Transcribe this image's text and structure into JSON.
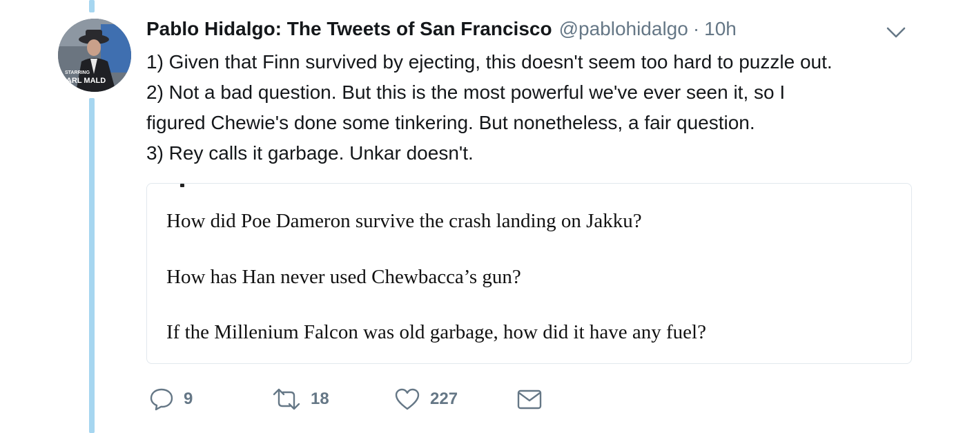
{
  "author": {
    "display_name": "Pablo Hidalgo: The Tweets of San Francisco",
    "handle": "@pablohidalgo",
    "separator": "·",
    "time": "10h",
    "avatar_text": {
      "line1": "STARRING",
      "line2": "KARL MALD"
    }
  },
  "tweet": {
    "lines": [
      "1) Given that Finn survived by ejecting, this doesn't seem too hard to puzzle out.",
      "2) Not a bad question. But this is the most powerful we've ever seen it, so I",
      "figured Chewie's done some tinkering. But nonetheless, a fair question.",
      "3) Rey calls it garbage. Unkar doesn't."
    ]
  },
  "media": {
    "questions": [
      "How did Poe Dameron survive the crash landing on Jakku?",
      "How has Han never used Chewbacca’s gun?",
      "If the Millenium Falcon was old garbage, how did it have any fuel?"
    ]
  },
  "actions": {
    "reply": {
      "icon": "reply-icon",
      "count": "9"
    },
    "retweet": {
      "icon": "retweet-icon",
      "count": "18"
    },
    "like": {
      "icon": "heart-icon",
      "count": "227"
    },
    "dm": {
      "icon": "envelope-icon"
    }
  },
  "colors": {
    "thread_line": "#a6d6f0",
    "secondary_text": "#657786",
    "primary_text": "#14171a",
    "card_border": "#e1e8ed"
  }
}
